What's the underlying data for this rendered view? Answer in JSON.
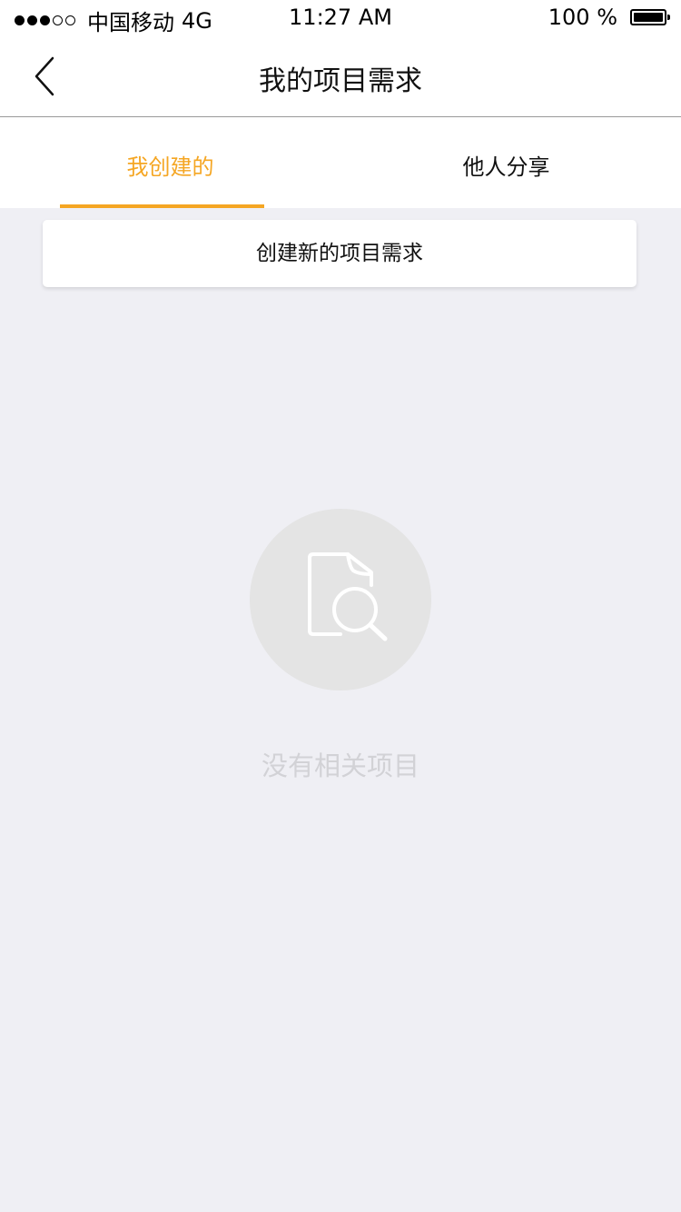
{
  "status_bar": {
    "carrier": "中国移动",
    "network": "4G",
    "time": "11:27 AM",
    "battery_text": "100 %",
    "battery_level": 1.0
  },
  "nav": {
    "title": "我的项目需求"
  },
  "tabs": [
    {
      "label": "我创建的",
      "active": true
    },
    {
      "label": "他人分享",
      "active": false
    }
  ],
  "create_button": {
    "label": "创建新的项目需求"
  },
  "empty_state": {
    "icon": "document-search-icon",
    "message": "没有相关项目"
  },
  "colors": {
    "accent": "#f5a623",
    "background": "#efeff4",
    "empty_text": "#d2d2d6"
  }
}
